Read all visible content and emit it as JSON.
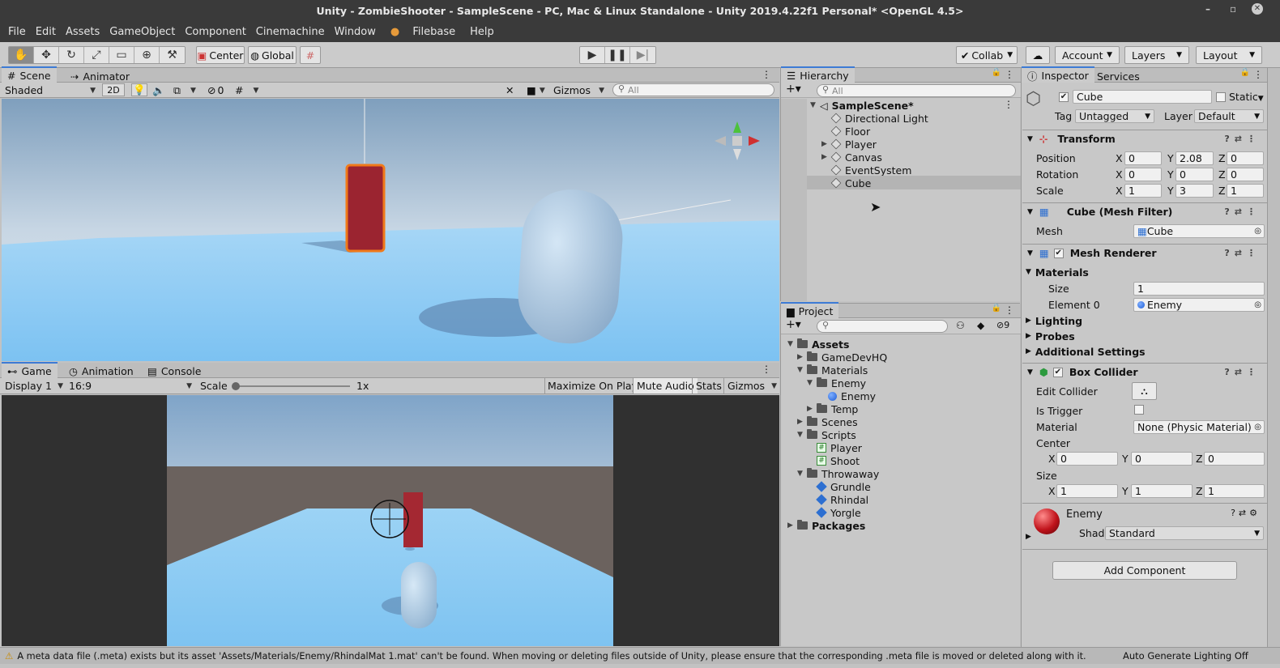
{
  "window": {
    "title": "Unity - ZombieShooter - SampleScene - PC, Mac & Linux Standalone - Unity 2019.4.22f1 Personal* <OpenGL 4.5>"
  },
  "menu": [
    "File",
    "Edit",
    "Assets",
    "GameObject",
    "Component",
    "Cinemachine",
    "Window",
    "Filebase",
    "Help"
  ],
  "toolbar": {
    "center": "Center",
    "global": "Global",
    "collab": "Collab",
    "account": "Account",
    "layers": "Layers",
    "layout": "Layout"
  },
  "scene": {
    "tabs": [
      "Scene",
      "Animator"
    ],
    "shading": "Shaded",
    "mode2d": "2D",
    "hidden_count": "0",
    "gizmos": "Gizmos",
    "search_placeholder": "All"
  },
  "game": {
    "tabs": [
      "Game",
      "Animation",
      "Console"
    ],
    "display": "Display 1",
    "aspect": "16:9",
    "scale_label": "Scale",
    "scale_value": "1x",
    "buttons": [
      "Maximize On Play",
      "Mute Audio",
      "Stats",
      "Gizmos"
    ]
  },
  "hierarchy": {
    "tab": "Hierarchy",
    "search_placeholder": "All",
    "scene": "SampleScene*",
    "items": [
      "Directional Light",
      "Floor",
      "Player",
      "Canvas",
      "EventSystem",
      "Cube"
    ]
  },
  "project": {
    "tab": "Project",
    "hidden_count": "9",
    "items": [
      "Assets",
      "GameDevHQ",
      "Materials",
      "Enemy",
      "Enemy",
      "Temp",
      "Scenes",
      "Scripts",
      "Player",
      "Shoot",
      "Throwaway",
      "Grundle",
      "Rhindal",
      "Yorgle",
      "Packages"
    ]
  },
  "inspector": {
    "tabs": [
      "Inspector",
      "Services"
    ],
    "name": "Cube",
    "static": "Static",
    "tag_label": "Tag",
    "tag": "Untagged",
    "layer_label": "Layer",
    "layer": "Default",
    "transform": {
      "title": "Transform",
      "position": "Position",
      "rotation": "Rotation",
      "scale": "Scale",
      "pos": [
        "0",
        "2.08",
        "0"
      ],
      "rot": [
        "0",
        "0",
        "0"
      ],
      "scl": [
        "1",
        "3",
        "1"
      ]
    },
    "axis": [
      "X",
      "Y",
      "Z"
    ],
    "mesh_filter": {
      "title": "Cube (Mesh Filter)",
      "mesh_label": "Mesh",
      "mesh": "Cube"
    },
    "mesh_renderer": {
      "title": "Mesh Renderer",
      "materials": "Materials",
      "size_label": "Size",
      "size": "1",
      "element0_label": "Element 0",
      "element0": "Enemy",
      "lighting": "Lighting",
      "probes": "Probes",
      "additional": "Additional Settings"
    },
    "box_collider": {
      "title": "Box Collider",
      "edit_collider": "Edit Collider",
      "is_trigger": "Is Trigger",
      "material_label": "Material",
      "material": "None (Physic Material)",
      "center": "Center",
      "center_vals": [
        "0",
        "0",
        "0"
      ],
      "size": "Size",
      "size_vals": [
        "1",
        "1",
        "1"
      ]
    },
    "material": {
      "name": "Enemy",
      "shader_label": "Shader",
      "shader": "Standard"
    },
    "add_component": "Add Component"
  },
  "status": {
    "message": "A meta data file (.meta) exists but its asset 'Assets/Materials/Enemy/RhindalMat 1.mat' can't be found. When moving or deleting files outside of Unity, please ensure that the corresponding .meta file is moved or deleted along with it.",
    "lighting": "Auto Generate Lighting Off"
  },
  "colors": {
    "accent": "#3d7bd5",
    "title_bg": "#3a3a3a",
    "panel_bg": "#c2c2c2",
    "cube_red": "#9b2430",
    "selection_orange": "#f07a1a"
  }
}
